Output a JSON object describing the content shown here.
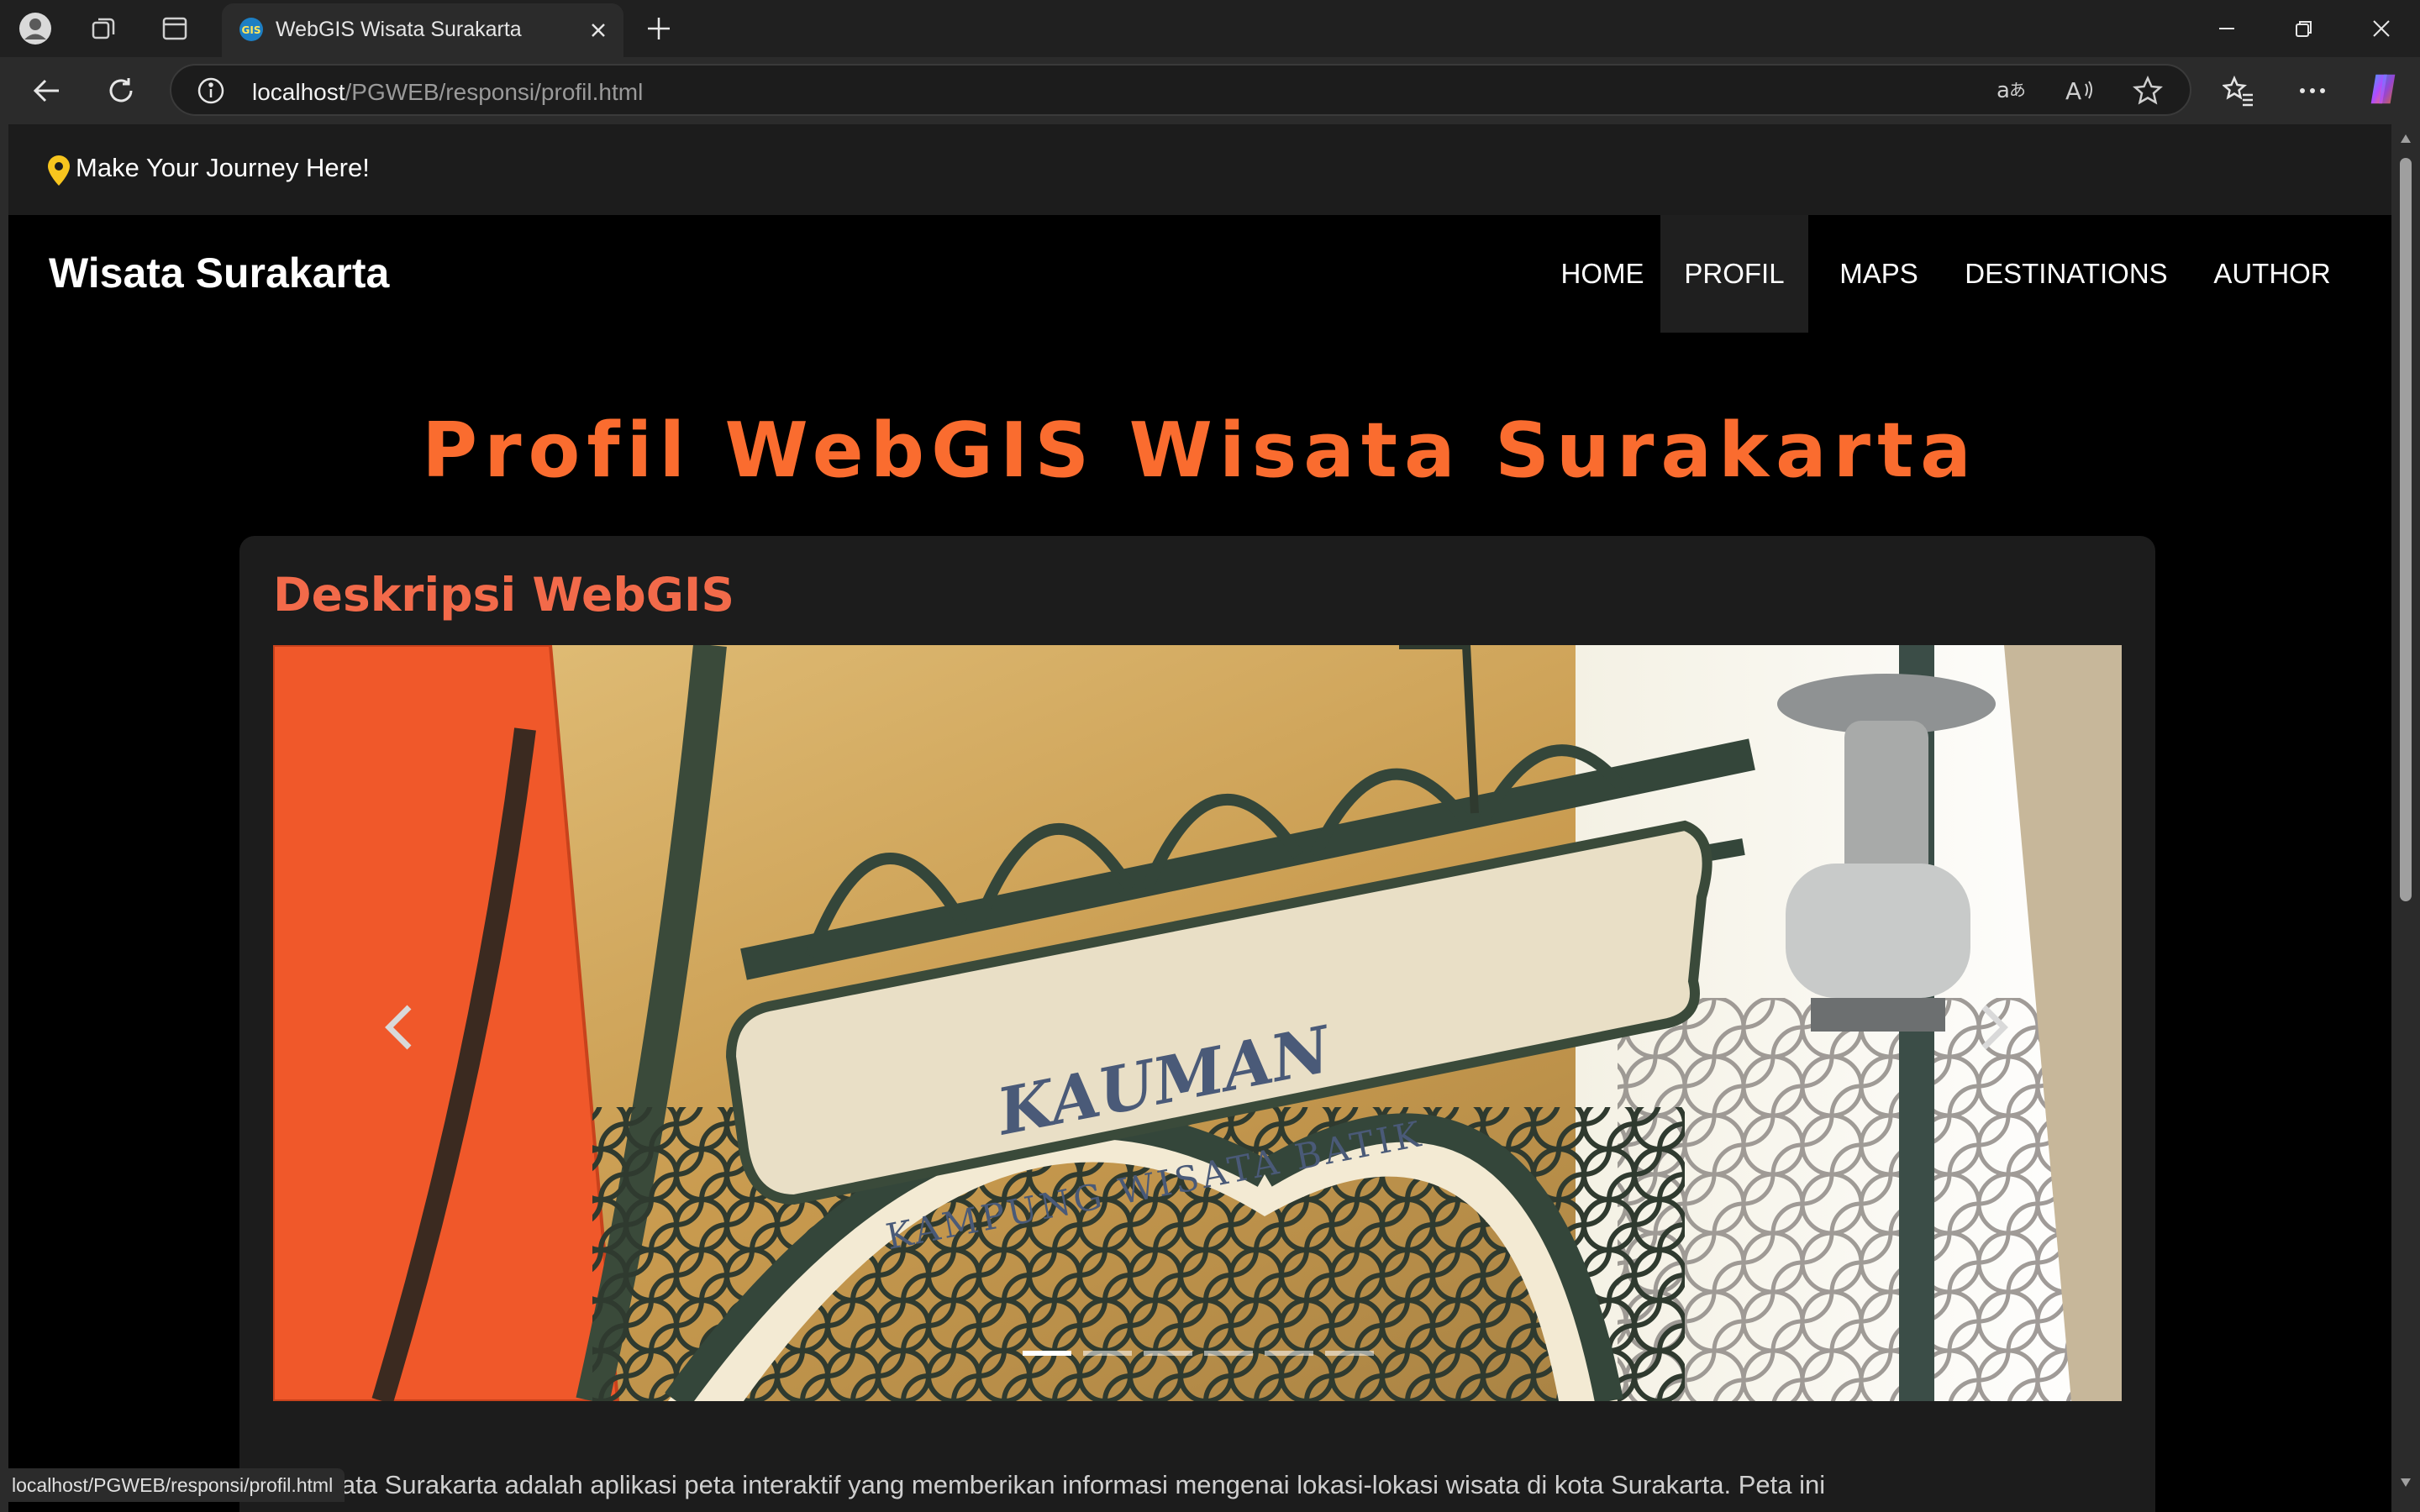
{
  "browser": {
    "tab_title": "WebGIS Wisata Surakarta",
    "url_host": "localhost",
    "url_path": "/PGWEB/responsi/profil.html",
    "status_url": "localhost/PGWEB/responsi/profil.html"
  },
  "topbar": {
    "tagline": "Make Your Journey Here!"
  },
  "navbar": {
    "brand": "Wisata Surakarta",
    "items": [
      {
        "label": "HOME"
      },
      {
        "label": "PROFIL"
      },
      {
        "label": "MAPS"
      },
      {
        "label": "DESTINATIONS"
      },
      {
        "label": "AUTHOR"
      }
    ],
    "active_index": 1
  },
  "page": {
    "title": "Profil WebGIS Wisata Surakarta",
    "section_title": "Deskripsi WebGIS",
    "description_partial": "S Wisata Surakarta adalah aplikasi peta interaktif yang memberikan informasi mengenai lokasi-lokasi wisata di kota Surakarta. Peta ini"
  },
  "carousel": {
    "sign_title": "KAUMAN",
    "sign_subtitle": "KAMPUNG WISATA BATIK",
    "slide_count": 6,
    "active_slide": 0
  },
  "colors": {
    "title_orange": "#fa6c2f",
    "section_orange": "#f26a4a",
    "pin_yellow": "#f7c51e"
  }
}
